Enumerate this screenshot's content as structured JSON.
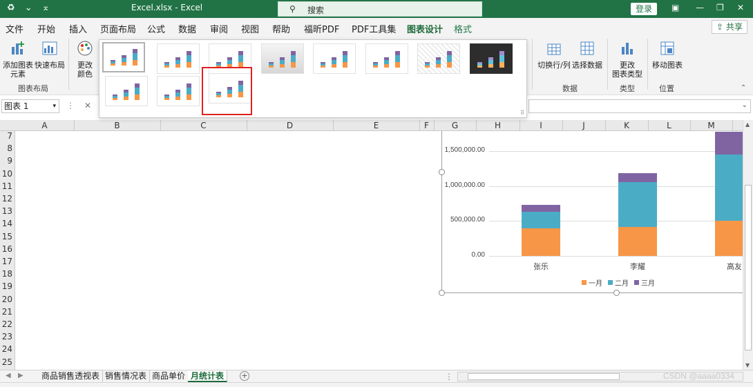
{
  "titlebar": {
    "autosave_icon": "autosave-icon",
    "undo_icon": "undo-icon",
    "customize_icon": "customize-qat-icon",
    "title": "Excel.xlsx  -  Excel",
    "search_placeholder": "搜索",
    "login": "登录",
    "win_ribbon": "▣",
    "win_min": "—",
    "win_max": "❐",
    "win_close": "✕"
  },
  "menu": {
    "tabs": [
      "文件",
      "开始",
      "插入",
      "页面布局",
      "公式",
      "数据",
      "审阅",
      "视图",
      "帮助",
      "福昕PDF",
      "PDF工具集",
      "图表设计",
      "格式"
    ],
    "active": "图表设计",
    "share": "共享"
  },
  "ribbon": {
    "add_element_1": "添加图表",
    "add_element_2": "元素",
    "quick_layout": "快速布局",
    "change_color_1": "更改",
    "change_color_2": "颜色",
    "group_layout": "图表布局",
    "switch_rowcol": "切换行/列",
    "select_data": "选择数据",
    "group_data": "数据",
    "change_type_1": "更改",
    "change_type_2": "图表类型",
    "group_type": "类型",
    "move_chart": "移动图表",
    "group_location": "位置"
  },
  "formula": {
    "namebox": "图表 1"
  },
  "grid": {
    "columns": [
      "A",
      "B",
      "C",
      "D",
      "E",
      "F",
      "G",
      "H",
      "I",
      "J",
      "K",
      "L",
      "M"
    ],
    "rows": [
      "7",
      "8",
      "9",
      "10",
      "11",
      "12",
      "13",
      "14",
      "15",
      "16",
      "17",
      "18",
      "19",
      "20",
      "21",
      "22",
      "23",
      "24",
      "25"
    ]
  },
  "chart_data": {
    "type": "bar",
    "stacked": true,
    "categories": [
      "张乐",
      "李耀",
      "高友"
    ],
    "series": [
      {
        "name": "一月",
        "color": "#f79646",
        "values": [
          390000,
          410000,
          500000
        ]
      },
      {
        "name": "二月",
        "color": "#4bacc6",
        "values": [
          240000,
          650000,
          950000
        ]
      },
      {
        "name": "三月",
        "color": "#8064a2",
        "values": [
          100000,
          120000,
          330000
        ]
      }
    ],
    "yticks": [
      "0.00",
      "500,000.00",
      "1,000,000.00",
      "1,500,000.00"
    ],
    "ylim": [
      0,
      1500000
    ],
    "legend": "bottom",
    "grid": true
  },
  "sheets": {
    "tabs": [
      "商品销售透视表",
      "销售情况表",
      "商品单价",
      "月统计表"
    ],
    "active": "月统计表",
    "add": "+"
  },
  "watermark": "CSDN @aaaa0334"
}
